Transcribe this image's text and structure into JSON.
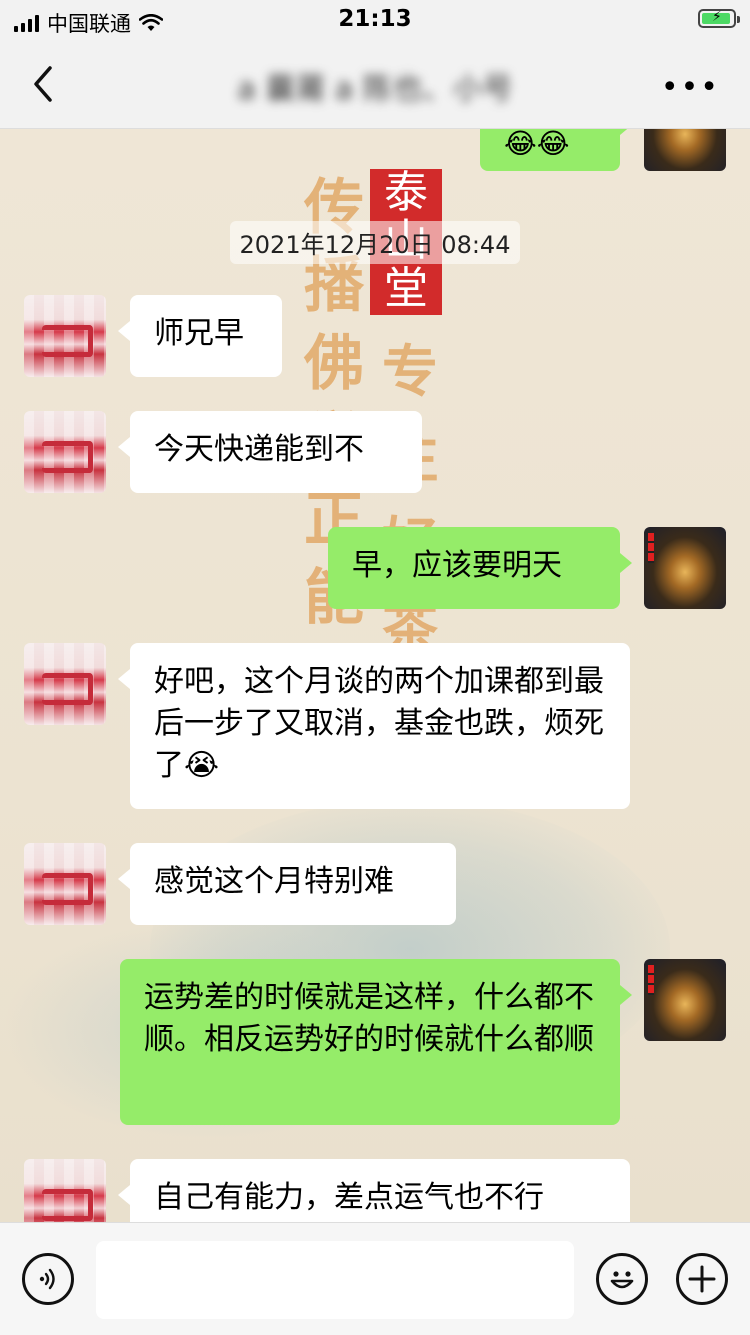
{
  "status": {
    "carrier": "中国联通",
    "time": "21:13"
  },
  "nav": {
    "title": "a 曩莆 a 陈也、小号"
  },
  "decor": {
    "seal": "泰\n山\n堂",
    "column1": "传播佛学正能量",
    "column2": "专注好茶",
    "emoji_top": "😂😂"
  },
  "chat": {
    "timestamp": "2021年12月20日 08:44",
    "messages": [
      {
        "side": "left",
        "text": "师兄早"
      },
      {
        "side": "left",
        "text": "今天快递能到不"
      },
      {
        "side": "right",
        "text": "早，应该要明天"
      },
      {
        "side": "left",
        "text": "好吧，这个月谈的两个加课都到最后一步了又取消，基金也跌，烦死了😭"
      },
      {
        "side": "left",
        "text": "感觉这个月特别难"
      },
      {
        "side": "right",
        "text": "运势差的时候就是这样，什么都不顺。相反运势好的时候就什么都顺"
      },
      {
        "side": "left",
        "text": "自己有能力，差点运气也不行"
      }
    ]
  },
  "input": {
    "value": "",
    "placeholder": ""
  },
  "icons": {
    "back": "chevron-left-icon",
    "more": "more-dots-icon",
    "voice": "voice-icon",
    "emoji": "emoji-icon",
    "plus": "plus-icon",
    "signal": "signal-icon",
    "wifi": "wifi-icon",
    "battery": "battery-charging-icon"
  },
  "colors": {
    "bubble_right": "#95ec69",
    "bubble_left": "#ffffff",
    "bar_bg": "#f2f2f2"
  }
}
